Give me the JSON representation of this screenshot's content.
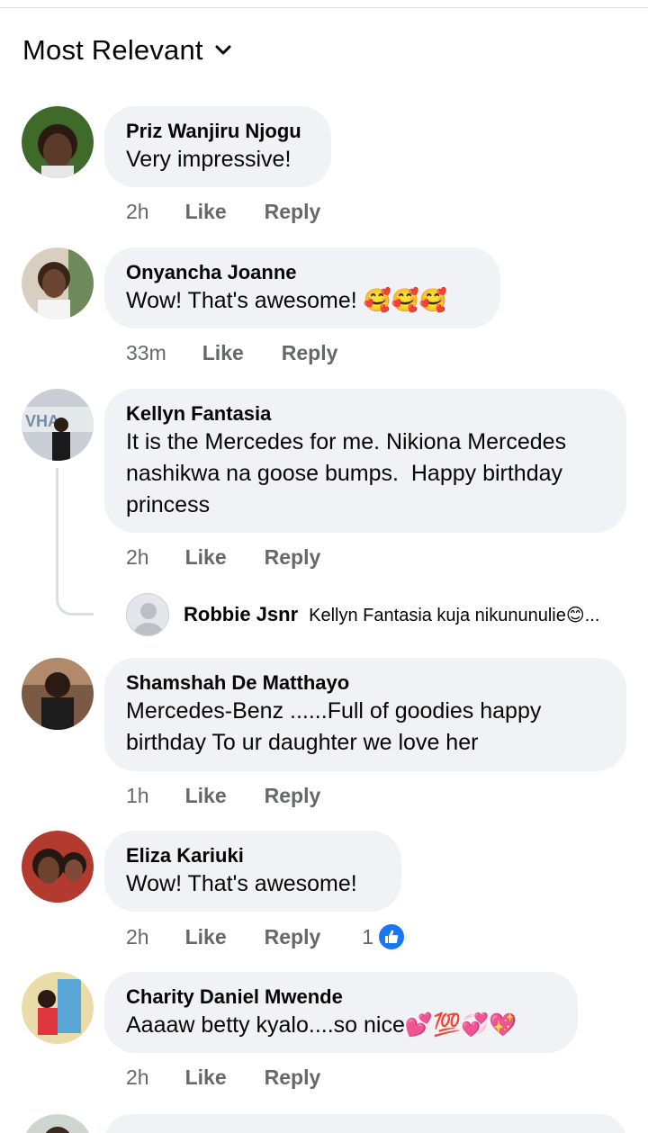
{
  "sort": {
    "label": "Most Relevant",
    "icon": "chevron-down-icon"
  },
  "comments": [
    {
      "name": "Priz Wanjiru Njogu",
      "text": "Very impressive!",
      "time": "2h",
      "like": "Like",
      "reply": "Reply"
    },
    {
      "name": "Onyancha Joanne",
      "text": "Wow! That's awesome! 🥰🥰🥰",
      "time": "33m",
      "like": "Like",
      "reply": "Reply"
    },
    {
      "name": "Kellyn Fantasia",
      "text": "It is the Mercedes for me. Nikiona Mercedes nashikwa na goose bumps.  Happy birthday princess",
      "time": "2h",
      "like": "Like",
      "reply": "Reply"
    },
    {
      "name": "Shamshah De Matthayo",
      "text": "Mercedes-Benz ......Full of goodies happy birthday To ur daughter we love her",
      "time": "1h",
      "like": "Like",
      "reply": "Reply"
    },
    {
      "name": "Eliza Kariuki",
      "text": "Wow! That's awesome!",
      "time": "2h",
      "like": "Like",
      "reply": "Reply",
      "reaction_count": "1"
    },
    {
      "name": "Charity Daniel Mwende",
      "text": "Aaaaw betty kyalo....so nice💕💯💞💖",
      "time": "2h",
      "like": "Like",
      "reply": "Reply"
    }
  ],
  "reply_preview": {
    "name": "Robbie Jsnr",
    "text": "Kellyn Fantasia kuja nikununulie😊..."
  },
  "colors": {
    "bubble": "#f0f2f5",
    "meta": "#65676b",
    "accent": "#1877f2"
  }
}
